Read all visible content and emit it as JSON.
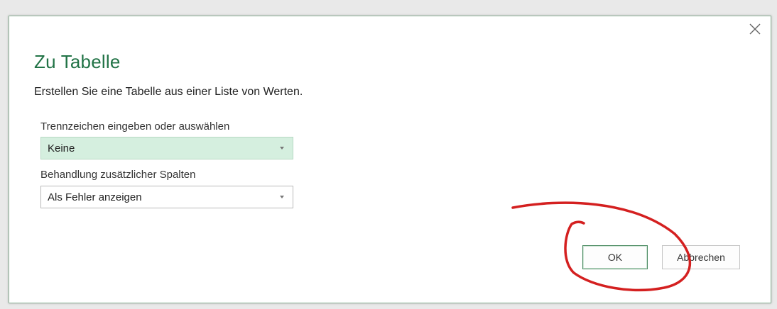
{
  "dialog": {
    "title": "Zu Tabelle",
    "subtitle": "Erstellen Sie eine Tabelle aus einer Liste von Werten.",
    "close_icon": "close-icon",
    "delimiter": {
      "label": "Trennzeichen eingeben oder auswählen",
      "value": "Keine"
    },
    "extra_columns": {
      "label": "Behandlung zusätzlicher Spalten",
      "value": "Als Fehler anzeigen"
    },
    "ok_label": "OK",
    "cancel_label": "Abbrechen"
  },
  "colors": {
    "accent": "#217346",
    "selected_field": "#d5efdf",
    "annotation": "#d42020"
  }
}
